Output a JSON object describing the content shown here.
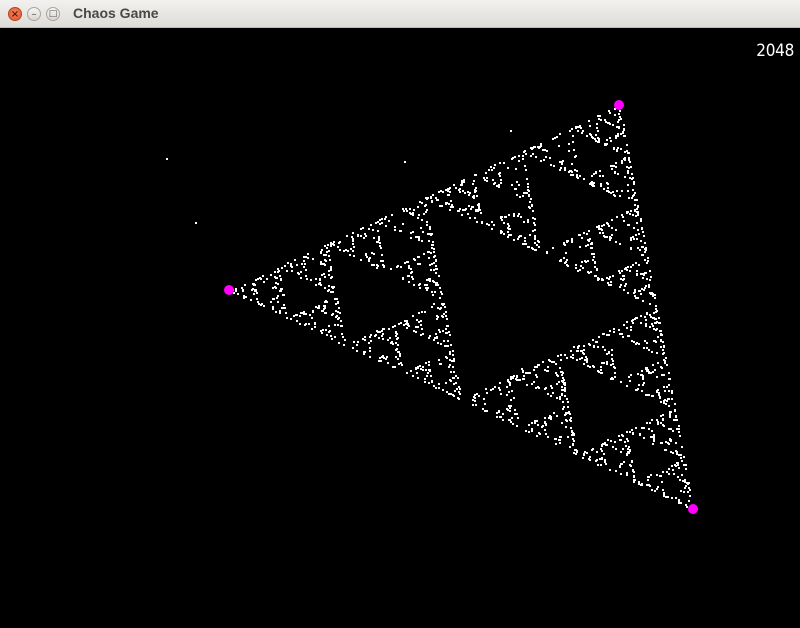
{
  "window": {
    "title": "Chaos Game",
    "close_glyph": "×",
    "minimize_glyph": "–",
    "maximize_glyph": "□"
  },
  "game": {
    "point_count": "2048",
    "point_color": "#ffffff",
    "vertex_color": "#ff00ff",
    "background": "#000000"
  }
}
